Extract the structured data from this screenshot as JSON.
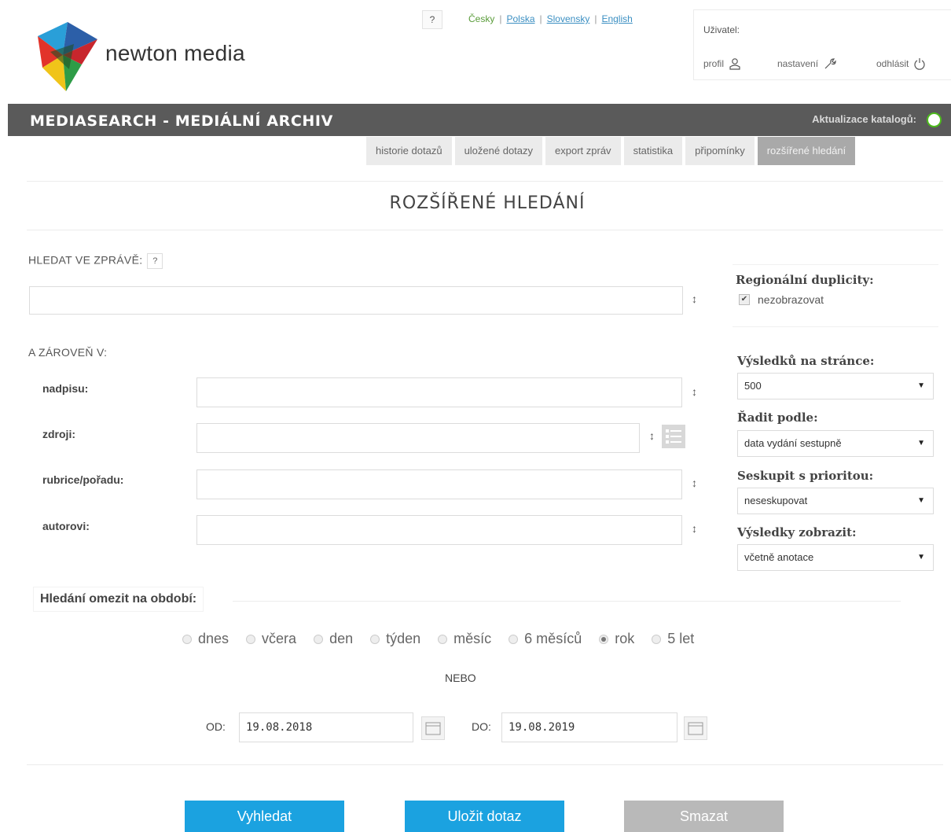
{
  "header": {
    "logo_text": "newton media",
    "help_label": "?",
    "languages": [
      {
        "label": "Česky",
        "active": true
      },
      {
        "label": "Polska",
        "active": false
      },
      {
        "label": "Slovensky",
        "active": false
      },
      {
        "label": "English",
        "active": false
      }
    ],
    "user": {
      "label": "Uživatel:",
      "profile": "profil",
      "settings": "nastavení",
      "logout": "odhlásit"
    }
  },
  "titlebar": {
    "app_title": "MEDIASEARCH - MEDIÁLNÍ ARCHIV",
    "catalog_update": "Aktualizace katalogů:",
    "status_color": "#4cbb1b"
  },
  "tabs": [
    {
      "label": "historie dotazů",
      "active": false
    },
    {
      "label": "uložené dotazy",
      "active": false
    },
    {
      "label": "export zpráv",
      "active": false
    },
    {
      "label": "statistika",
      "active": false
    },
    {
      "label": "připomínky",
      "active": false
    },
    {
      "label": "rozšířené hledání",
      "active": true
    }
  ],
  "page_title": "ROZŠÍŘENÉ HLEDÁNÍ",
  "search": {
    "label": "HLEDAT VE ZPRÁVĚ:",
    "help": "?",
    "value": "",
    "sort_glyph": "↕"
  },
  "also_in": {
    "label": "A ZÁROVEŇ V:",
    "fields": [
      {
        "label": "nadpisu:",
        "value": ""
      },
      {
        "label": "zdroji:",
        "value": ""
      },
      {
        "label": "rubrice/pořadu:",
        "value": ""
      },
      {
        "label": "autorovi:",
        "value": ""
      }
    ]
  },
  "right_panel": {
    "regional_title": "Regionální duplicity:",
    "regional_checkbox": {
      "label": "nezobrazovat",
      "checked": true
    },
    "per_page": {
      "label": "Výsledků na stránce:",
      "value": "500"
    },
    "sort_by": {
      "label": "Řadit podle:",
      "value": "data vydání sestupně"
    },
    "group_by": {
      "label": "Seskupit s prioritou:",
      "value": "neseskupovat"
    },
    "show": {
      "label": "Výsledky zobrazit:",
      "value": "včetně anotace"
    }
  },
  "period": {
    "label": "Hledání omezit na období:",
    "options": [
      {
        "label": "dnes",
        "checked": false
      },
      {
        "label": "včera",
        "checked": false
      },
      {
        "label": "den",
        "checked": false
      },
      {
        "label": "týden",
        "checked": false
      },
      {
        "label": "měsíc",
        "checked": false
      },
      {
        "label": "6 měsíců",
        "checked": false
      },
      {
        "label": "rok",
        "checked": true
      },
      {
        "label": "5 let",
        "checked": false
      }
    ],
    "or_label": "NEBO",
    "from_label": "OD:",
    "from_value": "19.08.2018",
    "to_label": "DO:",
    "to_value": "19.08.2019"
  },
  "buttons": {
    "search": "Vyhledat",
    "save": "Uložit dotaz",
    "clear": "Smazat"
  },
  "icons": {
    "profile": "user-icon",
    "settings": "wrench-icon",
    "logout": "power-icon",
    "source_list": "list-icon",
    "calendar": "calendar-icon"
  }
}
